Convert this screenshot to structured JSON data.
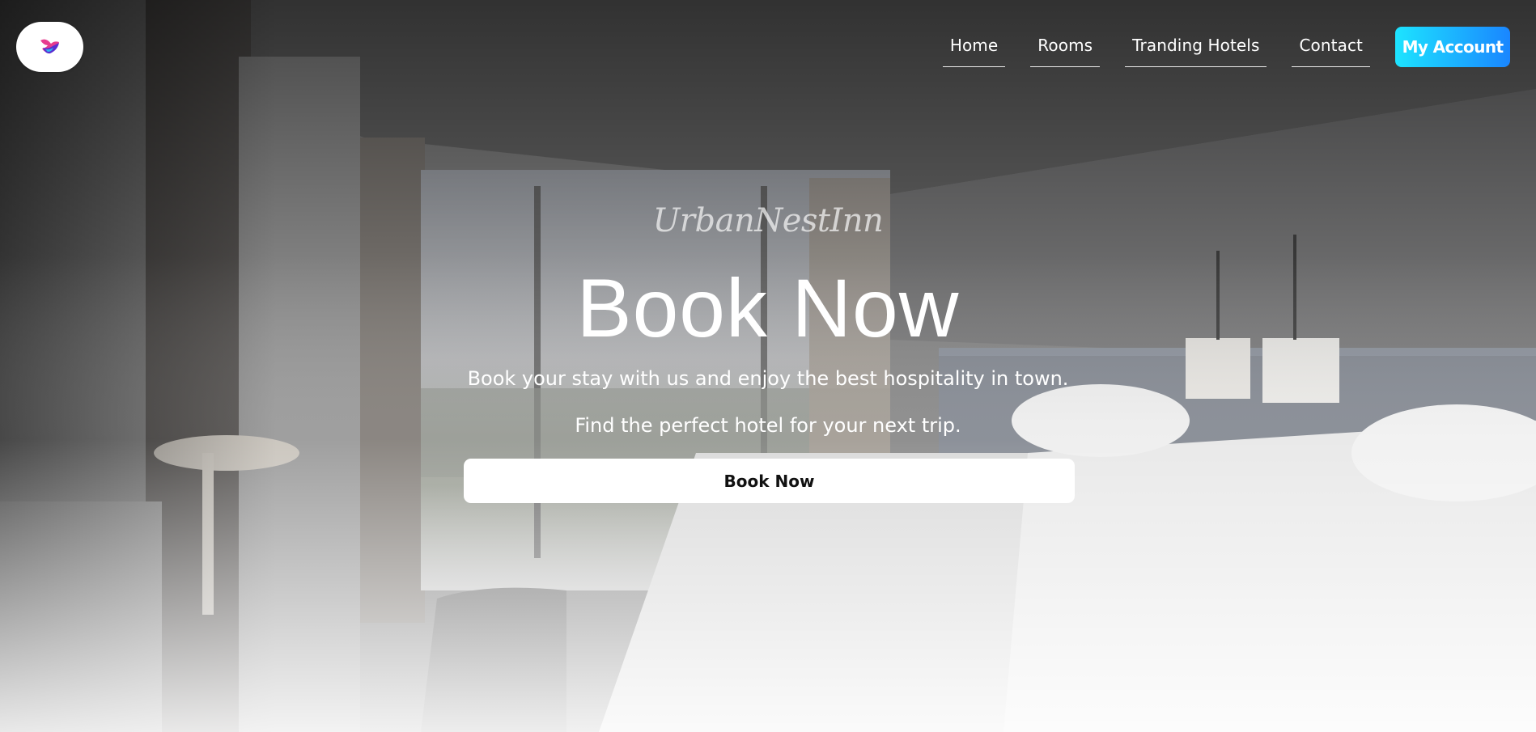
{
  "brand": {
    "logo_name": "colorful-bird-logo",
    "name": "UrbanNestInn"
  },
  "nav": {
    "items": [
      {
        "label": "Home"
      },
      {
        "label": "Rooms"
      },
      {
        "label": "Tranding Hotels"
      },
      {
        "label": "Contact"
      }
    ],
    "account_label": "My Account"
  },
  "hero": {
    "title": "Book Now",
    "tagline": "Book your stay with us and enjoy the best hospitality in town.",
    "subtagline": "Find the perfect hotel for your next trip.",
    "cta_label": "Book Now"
  },
  "colors": {
    "account_gradient_start": "#1de4ff",
    "account_gradient_end": "#1a86ff",
    "cta_background": "#ffffff",
    "hero_overlay_top": "#000000",
    "hero_overlay_bottom": "#ffffff"
  }
}
